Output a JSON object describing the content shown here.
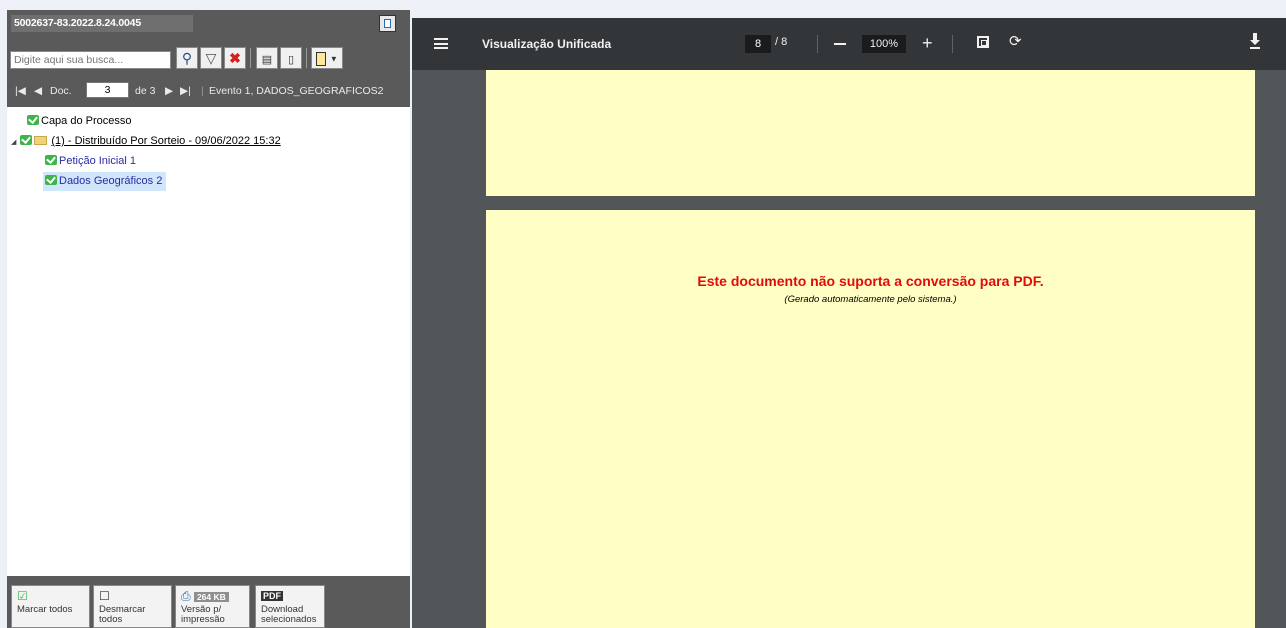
{
  "left_panel": {
    "case_number": "5002637-83.2022.8.24.0045",
    "search_placeholder": "Digite aqui sua busca...",
    "nav": {
      "doc_label": "Doc.",
      "doc_number": "3",
      "of_label": "de 3",
      "event_label": "Evento 1, DADOS_GEOGRAFICOS2"
    },
    "tree": {
      "cover": "Capa do Processo",
      "event": "(1) - Distribuído Por Sorteio - 09/06/2022 15:32",
      "docs": [
        "Petição Inicial 1",
        "Dados Geográficos 2"
      ]
    },
    "footer": {
      "mark_all": "Marcar todos",
      "unmark_all": "Desmarcar todos",
      "print_badge": "264 KB",
      "print_version": "Versão p/ impressão",
      "download_selected": "Download selecionados"
    }
  },
  "viewer": {
    "title": "Visualização Unificada",
    "page_current": "8",
    "page_total": "/ 8",
    "zoom": "100%",
    "message": "Este documento não suporta a conversão para PDF.",
    "message_sub": "(Gerado automaticamente pelo sistema.)"
  },
  "colors": {
    "panel_dark": "#5a5a5a",
    "viewer_toolbar": "#323639",
    "viewer_bg": "#535659",
    "page_bg": "#fefec5",
    "error_red": "#e20b0b",
    "link_blue": "#2a2aa6"
  },
  "icons": [
    "search-icon",
    "filter-icon",
    "clear-icon",
    "list-icon",
    "document-icon",
    "page-menu-icon",
    "menu-icon",
    "fit-page-icon",
    "rotate-icon",
    "download-icon",
    "checkbox-icon",
    "printer-icon",
    "pdf-icon"
  ]
}
